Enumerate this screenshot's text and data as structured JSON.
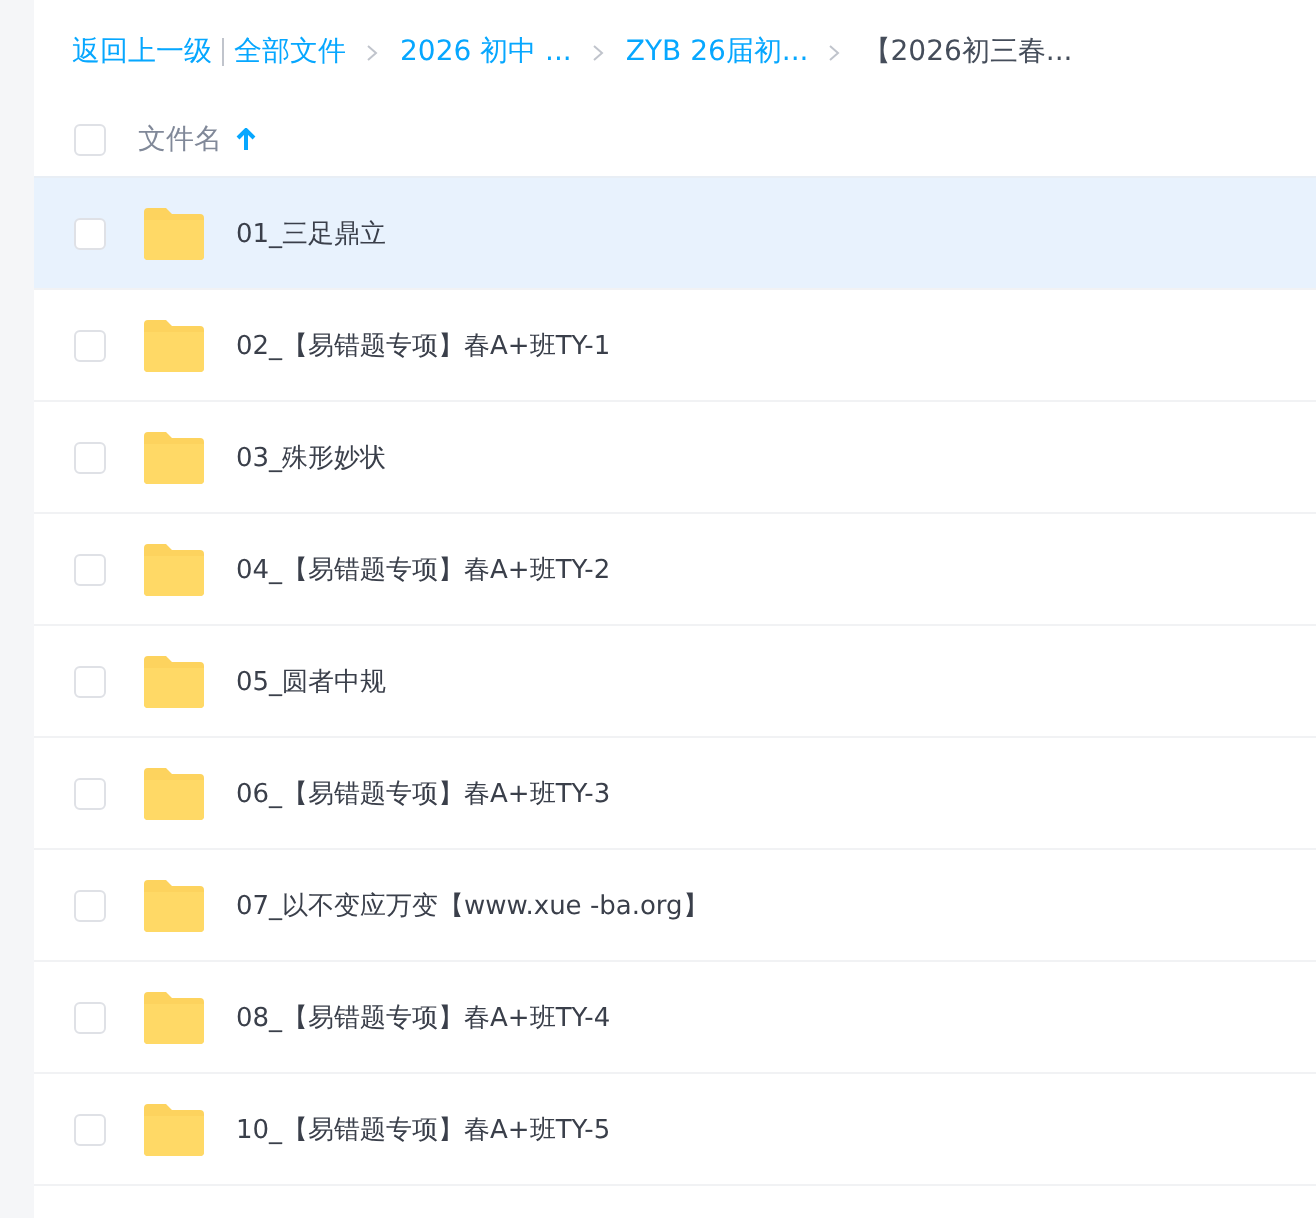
{
  "breadcrumb": {
    "back": "返回上一级",
    "items": [
      {
        "label": "全部文件",
        "current": false
      },
      {
        "label": "2026 初中 ...",
        "current": false
      },
      {
        "label": "ZYB 26届初...",
        "current": false
      },
      {
        "label": "【2026初三春...",
        "current": true
      }
    ]
  },
  "table": {
    "header": {
      "label": "文件名",
      "checked": false
    },
    "rows": [
      {
        "name": "01_三足鼎立",
        "selected": true,
        "checked": false
      },
      {
        "name": "02_【易错题专项】春A+班TY-1",
        "selected": false,
        "checked": false
      },
      {
        "name": "03_殊形妙状",
        "selected": false,
        "checked": false
      },
      {
        "name": "04_【易错题专项】春A+班TY-2",
        "selected": false,
        "checked": false
      },
      {
        "name": "05_圆者中规",
        "selected": false,
        "checked": false
      },
      {
        "name": "06_【易错题专项】春A+班TY-3",
        "selected": false,
        "checked": false
      },
      {
        "name": "07_以不变应万变【www.xue -ba.org】",
        "selected": false,
        "checked": false
      },
      {
        "name": "08_【易错题专项】春A+班TY-4",
        "selected": false,
        "checked": false
      },
      {
        "name": "10_【易错题专项】春A+班TY-5",
        "selected": false,
        "checked": false
      }
    ]
  }
}
